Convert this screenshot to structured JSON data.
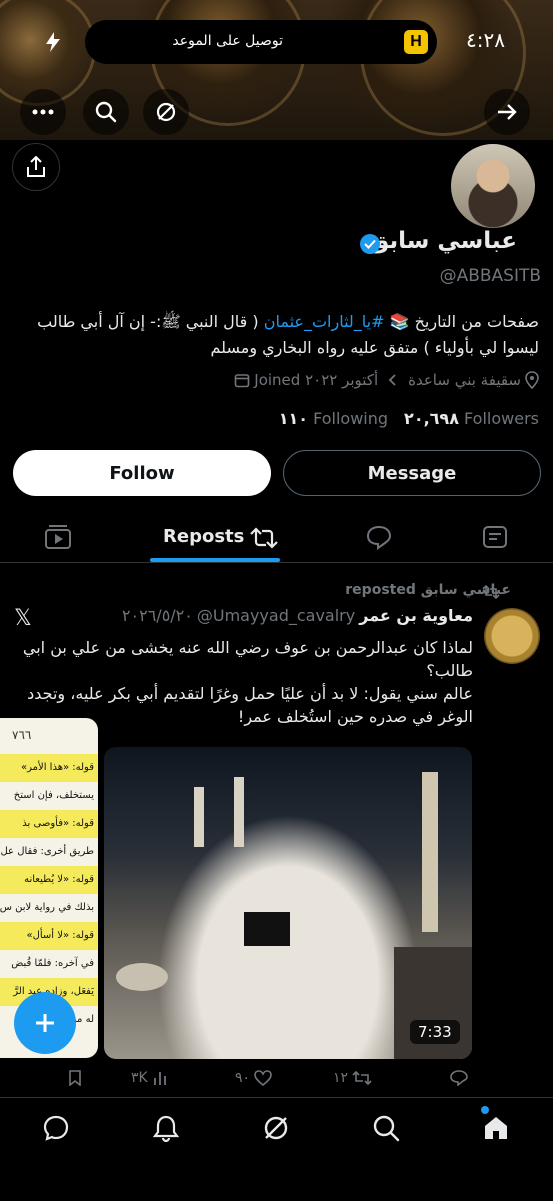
{
  "status_bar": {
    "time": "٤:٢٨",
    "notification": "توصيل على الموعد"
  },
  "banner": {
    "nav_icons": [
      "more-icon",
      "search-icon",
      "grok-icon",
      "back-arrow-icon"
    ]
  },
  "profile": {
    "name": "عباسي سابق",
    "handle": "@ABBASITB",
    "bio_part1": "صفحات من التاريخ 📚 ",
    "bio_hashtag": "#يا_لثارات_عثمان",
    "bio_part2": " ( قال النبي ﷺ:- إن آل أبي طالب ليسوا لي بأولياء ) متفق عليه رواه البخاري ومسلم",
    "location": "سقيفة بني ساعدة",
    "joined": "Joined أكتوبر ٢٠٢٢",
    "following_count": "١١٠",
    "following_label": "Following",
    "followers_count": "٢٠,٦٩٨",
    "followers_label": "Followers"
  },
  "buttons": {
    "follow": "Follow",
    "message": "Message"
  },
  "tabs": {
    "active_label": "Reposts",
    "icons": [
      "video-tab-icon",
      "reposts-tab-icon",
      "replies-tab-icon",
      "articles-tab-icon"
    ]
  },
  "post": {
    "reposted_by": "عباسي سابق reposted",
    "author_name": "معاوية بن عمر",
    "author_handle": "@Umayyad_cavalry",
    "date": "٢٠٢٦/٥/٢٠",
    "text": "لماذا كان عبدالرحمن بن عوف رضي الله عنه يخشى من علي بن ابي طالب؟\nعالم سني يقول: لا بد أن عليًا حمل وغرًا لتقديم أبي بكر عليه، وتجدد الوغر في صدره حين استُخلف عمر!",
    "video_duration": "7:33",
    "side_image_page": "٧٦٦",
    "side_image_lines": [
      "قوله: «هذا الأمر»",
      "يستخلف، فإن استخ",
      "قوله: «فأوصى بذ",
      "طريق أخرى: فقال عل",
      "قوله: «لا يُطيعانه",
      "بذلك في رواية لابن س",
      "قوله: «لا أسأل»",
      "في آخره: فلمّا قُبض",
      "يَفعَل، وزاده عبد الرَّ",
      "له من ماله وولده."
    ],
    "views": "٣K",
    "likes": "٩٠",
    "reposts": "١٢",
    "replies": ""
  },
  "bottom_nav": [
    "home-icon",
    "search-icon",
    "grok-icon",
    "notifications-icon",
    "messages-icon"
  ],
  "colors": {
    "accent": "#1d9bf0",
    "muted": "#71767b",
    "background": "#000000"
  }
}
